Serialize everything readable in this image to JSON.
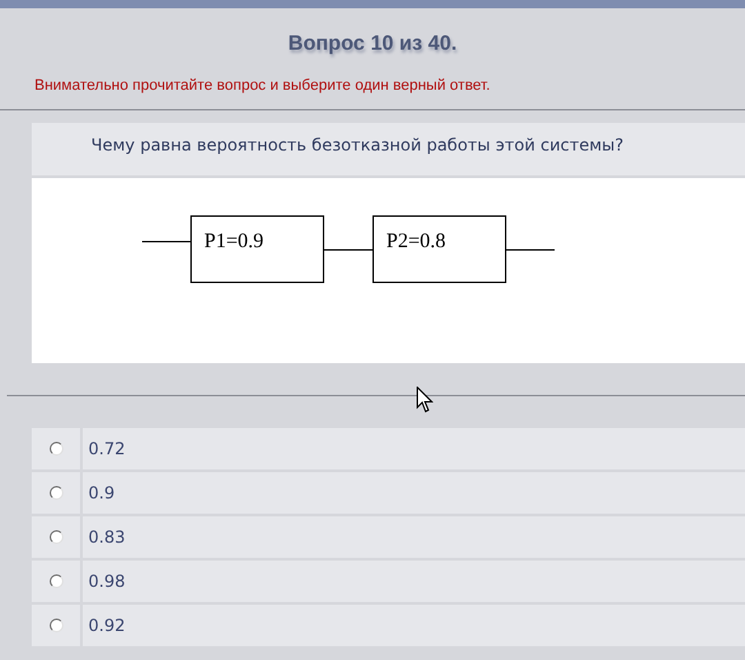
{
  "header": {
    "title": "Вопрос 10 из 40.",
    "instruction": "Внимательно прочитайте вопрос и выберите один верный ответ."
  },
  "question": {
    "text": "Чему равна вероятность безотказной работы этой системы?",
    "diagram": {
      "blocks": [
        {
          "label": "P1=0.9"
        },
        {
          "label": "P2=0.8"
        }
      ]
    }
  },
  "options": [
    {
      "label": "0.72",
      "selected": false
    },
    {
      "label": "0.9",
      "selected": false
    },
    {
      "label": "0.83",
      "selected": false
    },
    {
      "label": "0.98",
      "selected": false
    },
    {
      "label": "0.92",
      "selected": false
    }
  ]
}
